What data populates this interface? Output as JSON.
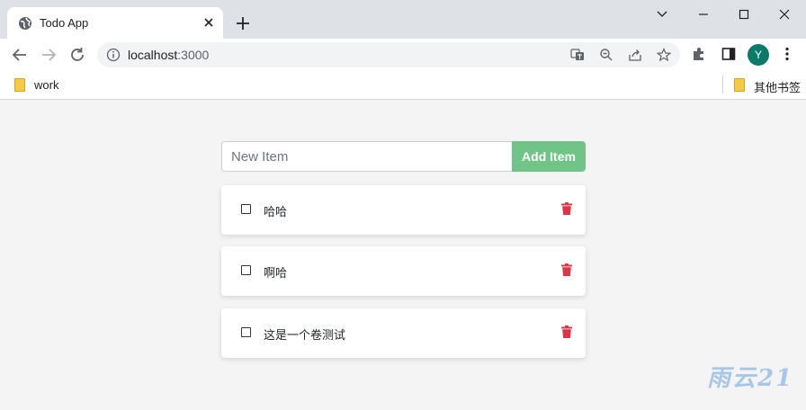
{
  "browser": {
    "tab_title": "Todo App",
    "url_host": "localhost",
    "url_port": ":3000",
    "avatar_letter": "Y",
    "bookmarks": [
      {
        "label": "work"
      },
      {
        "label": "其他书签"
      }
    ]
  },
  "app": {
    "input_placeholder": "New Item",
    "input_value": "",
    "add_button_label": "Add Item",
    "items": [
      {
        "text": "哈哈",
        "completed": false
      },
      {
        "text": "啊哈",
        "completed": false
      },
      {
        "text": "这是一个卷测试",
        "completed": false
      }
    ]
  },
  "watermark": "雨云21",
  "colors": {
    "accent_green": "#71c487",
    "trash_red": "#dc3545",
    "avatar": "#0b7a6a",
    "page_bg": "#f4f4f4"
  }
}
